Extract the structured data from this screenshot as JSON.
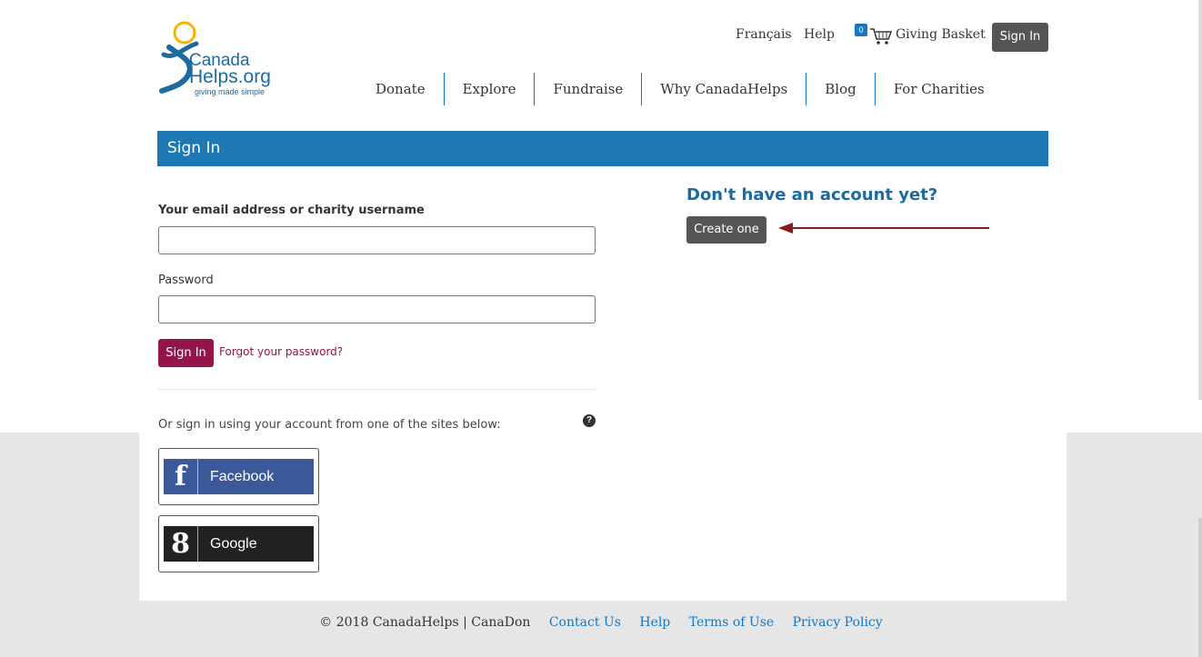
{
  "logo": {
    "line1": "Canada",
    "line2": "Helps.org",
    "tagline": "giving made simple"
  },
  "header": {
    "links": [
      "Français",
      "Help"
    ],
    "basket_count": "0",
    "basket_label": "Giving Basket",
    "signin_label": "Sign In"
  },
  "nav": [
    "Donate",
    "Explore",
    "Fundraise",
    "Why CanadaHelps",
    "Blog",
    "For Charities"
  ],
  "signin": {
    "title": "Sign In",
    "email_label": "Your email address or charity username",
    "password_label": "Password",
    "email_value": "",
    "password_value": "",
    "submit_label": "Sign In",
    "forgot_label": "Forgot your password?",
    "social_prompt": "Or sign in using your account from one of the sites below:",
    "facebook_label": "Facebook",
    "google_label": "Google",
    "facebook_glyph": "f",
    "google_glyph": "8",
    "help_glyph": "?"
  },
  "register": {
    "heading": "Don't have an account yet?",
    "button_label": "Create one"
  },
  "footer": {
    "copyright": "© 2018 CanadaHelps | CanaDon",
    "links": [
      "Contact Us",
      "Help",
      "Terms of Use",
      "Privacy Policy"
    ]
  },
  "colors": {
    "brand_blue": "#1e78b4",
    "signin_red": "#93154a",
    "arrow": "#8b1a1a"
  }
}
